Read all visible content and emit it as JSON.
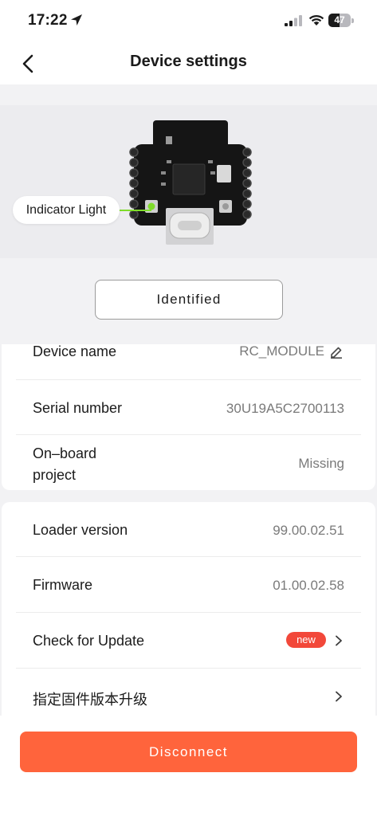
{
  "status_bar": {
    "time": "17:22",
    "battery": "47",
    "icons": [
      "location-arrow-icon",
      "cellular-signal-icon",
      "wifi-icon",
      "battery-icon"
    ]
  },
  "nav": {
    "title": "Device settings",
    "back_icon": "chevron-left-icon"
  },
  "hero": {
    "indicator_label": "Indicator Light",
    "indicator_color": "#7fdc2a",
    "identified_label": "Identified"
  },
  "device_info": [
    {
      "label": "Device name",
      "value": "RC_MODULE",
      "editable": true
    },
    {
      "label": "Serial number",
      "value": "30U19A5C2700113"
    },
    {
      "label": "On–board project",
      "value": "Missing"
    }
  ],
  "firmware_info": [
    {
      "label": "Loader version",
      "value": "99.00.02.51"
    },
    {
      "label": "Firmware",
      "value": "01.00.02.58"
    },
    {
      "label": "Check for Update",
      "badge": "new"
    },
    {
      "label": "指定固件版本升级"
    }
  ],
  "footer": {
    "disconnect_label": "Disconnect",
    "accent_color": "#ff643c"
  }
}
